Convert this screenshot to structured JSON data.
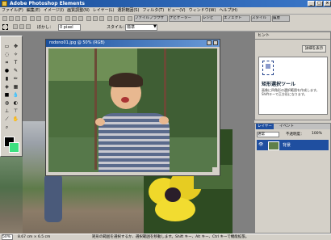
{
  "app": {
    "title": "Adobe Photoshop Elements"
  },
  "window_controls": {
    "minimize": "_",
    "maximize": "□",
    "close": "×"
  },
  "menu": [
    "ファイル(F)",
    "編集(E)",
    "イメージ(I)",
    "画質調整(N)",
    "レイヤー(L)",
    "選択範囲(S)",
    "フィルタ(T)",
    "ビュー(V)",
    "ウィンドウ(W)",
    "ヘルプ(H)"
  ],
  "palette_tabs": [
    "ファイルブラウザ",
    "ナビゲーター",
    "レシピ",
    "エフェクト",
    "スタイル",
    "履歴"
  ],
  "options": {
    "style_label": "スタイル：",
    "style_value": "標準",
    "feather_label": "ぼかし：",
    "feather_value": "0 pixel"
  },
  "document": {
    "title": "rodono01.jpg @ 50% (RGB)"
  },
  "hints": {
    "header": "ヒント",
    "button": "詳細を表示",
    "tool_name": "矩形選択ツール",
    "body": "画像に四角形の選択範囲を作成します。Shiftキーで正方形になります。"
  },
  "layers": {
    "tab_label": "レイヤー",
    "tab2_label": "イベント",
    "mode": "通常",
    "opacity_label": "不透明度：",
    "opacity": "100%",
    "layer_name": "背景"
  },
  "status": {
    "zoom": "50%",
    "dims": "8.67 cm × 6.5 cm",
    "message": "矩形の範囲を選択するか、選択範囲を移動します。Shift キー、Alt キー、Ctrl キーで機能拡張。"
  },
  "colors": {
    "foreground": "#000000",
    "background": "#3ce07f"
  }
}
